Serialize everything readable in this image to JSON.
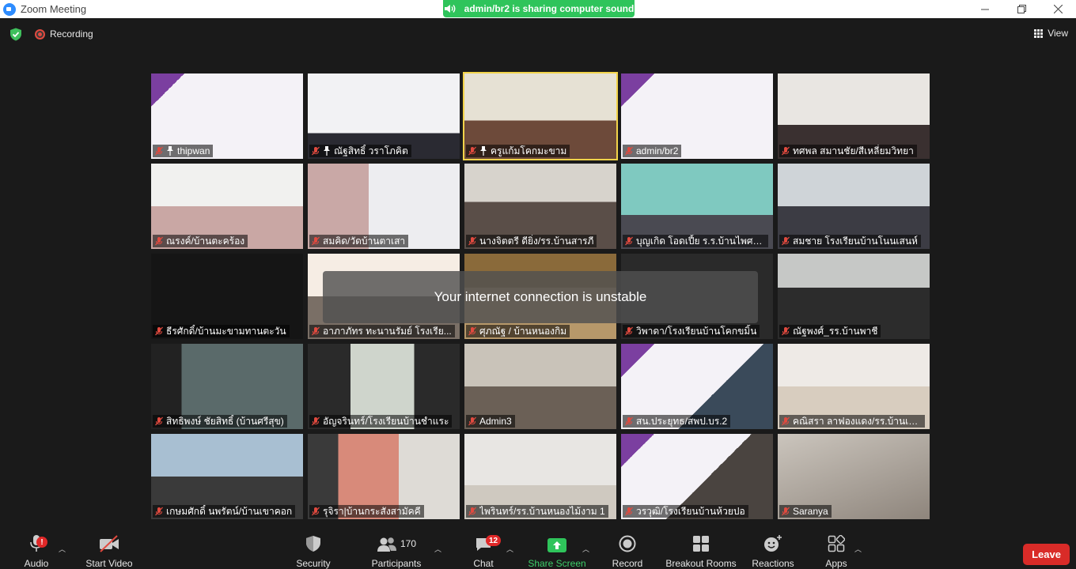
{
  "window": {
    "title": "Zoom Meeting"
  },
  "share_banner": "admin/br2 is sharing computer sound",
  "recording": "Recording",
  "view_label": "View",
  "toast": "Your internet connection is unstable",
  "participants": [
    {
      "name": "thipwan",
      "pinned": true
    },
    {
      "name": "ณัฐสิทธิ์ วราโภคิต",
      "pinned": true
    },
    {
      "name": "ครูแก้มโคกมะขาม",
      "pinned": true
    },
    {
      "name": "admin/br2",
      "pinned": false
    },
    {
      "name": "ทศพล สมานชัย/สีเหลี่ยมวิทยา",
      "pinned": false
    },
    {
      "name": "ณรงค์/บ้านตะคร้อง",
      "pinned": false
    },
    {
      "name": "สมคิด/วัดบ้านตาเสา",
      "pinned": false
    },
    {
      "name": "นางจิตตรี  ดียิ่ง/รร.บ้านสารภี",
      "pinned": false
    },
    {
      "name": "บุญเกิด โอดเปี้ย ร.ร.บ้านไพศาลส...",
      "pinned": false
    },
    {
      "name": "สมชาย  โรงเรียนบ้านโนนเสนห์",
      "pinned": false
    },
    {
      "name": "ธีรศักดิ์/บ้านมะขามทานตะวัน",
      "pinned": false
    },
    {
      "name": "อาภาภัทร  ทะนานรัมย์  โรงเรีย...",
      "pinned": false
    },
    {
      "name": "ศุภณัฐ / บ้านหนองกิม",
      "pinned": false
    },
    {
      "name": "วิพาดา/โรงเรียนบ้านโคกขมิ้น",
      "pinned": false
    },
    {
      "name": "ณัฐพงศ์_รร.บ้านพาชี",
      "pinned": false
    },
    {
      "name": "สิทธิพงษ์ ชัยสิทธิ์ (บ้านศรีสุข)",
      "pinned": false
    },
    {
      "name": "อัญจรินทร์/โรงเรียนบ้านชำแระ",
      "pinned": false
    },
    {
      "name": "Admin3",
      "pinned": false
    },
    {
      "name": "สน.ประยุทธ/สพป.บร.2",
      "pinned": false
    },
    {
      "name": "คณิสรา ลาฟองแดง/รร.บ้านเพช...",
      "pinned": false
    },
    {
      "name": "เกษมศักดิ์ นพรัตน์/บ้านเขาคอก",
      "pinned": false
    },
    {
      "name": "รุจิรา|บ้านกระสังสามัคคี",
      "pinned": false
    },
    {
      "name": "ไพรินทร์/รร.บ้านหนองไม้งาม 1",
      "pinned": false
    },
    {
      "name": "วรวุฒิ/โรงเรียนบ้านห้วยปอ",
      "pinned": false
    },
    {
      "name": "Saranya",
      "pinned": false
    }
  ],
  "toolbar": {
    "audio": "Audio",
    "audio_badge": "!",
    "start_video": "Start Video",
    "security": "Security",
    "participants": "Participants",
    "participants_count": "170",
    "chat": "Chat",
    "chat_badge": "12",
    "share_screen": "Share Screen",
    "record": "Record",
    "breakout_rooms": "Breakout Rooms",
    "reactions": "Reactions",
    "apps": "Apps",
    "leave": "Leave"
  },
  "colors": {
    "accent_green": "#2fc45b",
    "active_speaker": "#f2d34a",
    "leave_red": "#d92b28",
    "mute_red": "#e14a3f"
  }
}
